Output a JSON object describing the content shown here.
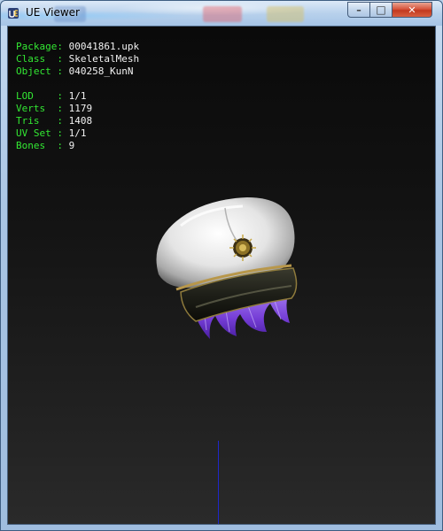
{
  "window": {
    "title": "UE Viewer",
    "minimize_glyph": "–",
    "maximize_glyph": "□",
    "close_glyph": "✕",
    "icon": "ue-viewer-app-icon"
  },
  "info": {
    "package": {
      "label": "Package:",
      "value": "00041861.upk"
    },
    "class": {
      "label": "Class  :",
      "value": "SkeletalMesh"
    },
    "object": {
      "label": "Object :",
      "value": "040258_KunN"
    },
    "lod": {
      "label": "LOD    :",
      "value": "1/1"
    },
    "verts": {
      "label": "Verts  :",
      "value": "1179"
    },
    "tris": {
      "label": "Tris   :",
      "value": "1408"
    },
    "uvset": {
      "label": "UV Set :",
      "value": "1/1"
    },
    "bones": {
      "label": "Bones  :",
      "value": "9"
    }
  },
  "colors": {
    "label_green": "#33e833",
    "value_white": "#f2f2f2",
    "axis_blue": "#1f27c9"
  }
}
